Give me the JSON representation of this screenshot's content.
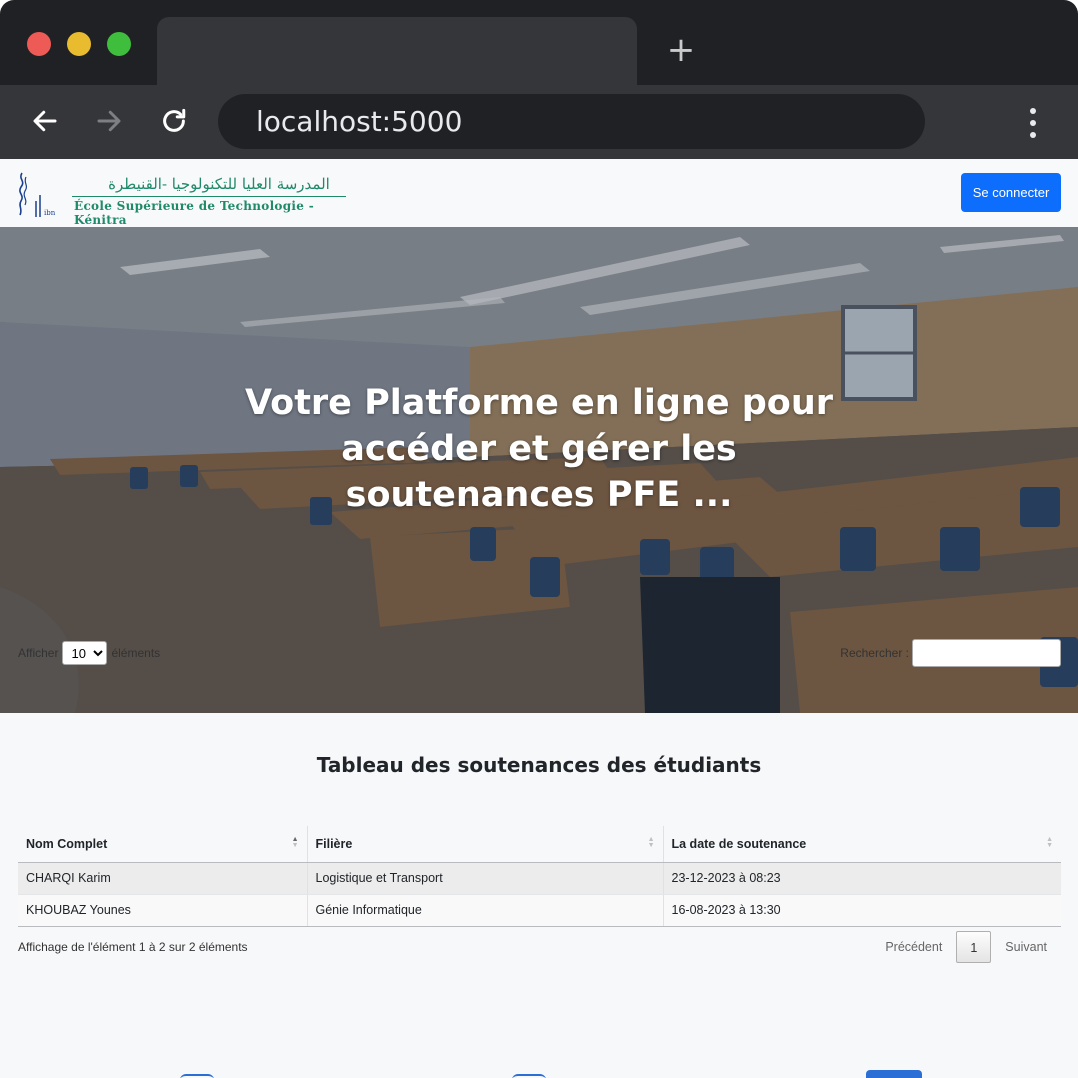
{
  "browser": {
    "url": "localhost:5000",
    "new_tab_symbol": "+"
  },
  "header": {
    "logo_arabic": "المدرسة العليا للتكنولوجيا -القنيطرة",
    "logo_latin": "École Supérieure de Technologie -Kénitra",
    "login_label": "Se connecter"
  },
  "hero": {
    "title": "Votre Platforme en ligne pour accéder et gérer les soutenances PFE ..."
  },
  "section": {
    "title": "Tableau des soutenances des étudiants"
  },
  "datatable": {
    "length_prefix": "Afficher",
    "length_value": "10",
    "length_suffix": "éléments",
    "search_label": "Rechercher :",
    "columns": [
      "Nom Complet",
      "Filière",
      "La date de soutenance"
    ],
    "rows": [
      [
        "CHARQI Karim",
        "Logistique et Transport",
        "23-12-2023 à 08:23"
      ],
      [
        "KHOUBAZ Younes",
        "Génie Informatique",
        "16-08-2023 à 13:30"
      ]
    ],
    "info": "Affichage de l'élément 1 à 2 sur 2 éléments",
    "prev_label": "Précédent",
    "current_page": "1",
    "next_label": "Suivant"
  },
  "colors": {
    "primary": "#0d6efd",
    "chrome_dark": "#202124",
    "chrome_mid": "#35363a",
    "logo_green": "#1f8a6a"
  }
}
